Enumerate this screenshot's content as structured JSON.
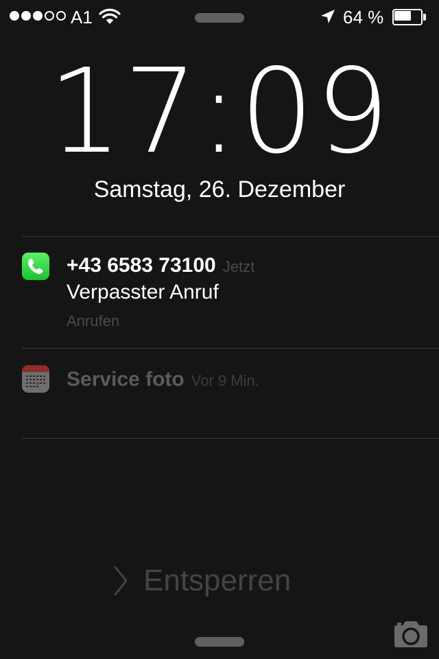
{
  "status_bar": {
    "signal_bars_filled": 3,
    "signal_bars_total": 5,
    "carrier": "A1",
    "wifi_icon": "wifi-icon",
    "location_icon": "location-arrow-icon",
    "battery_text": "64 %",
    "battery_level": 0.64
  },
  "lock_screen": {
    "time": "17:09",
    "date": "Samstag, 26. Dezember"
  },
  "notifications": [
    {
      "app_icon": "phone-app-icon",
      "title": "+43 6583 73100",
      "time": "Jetzt",
      "body": "Verpasster Anruf",
      "action": "Anrufen"
    },
    {
      "app_icon": "calendar-app-icon",
      "title": "Service foto",
      "time": "Vor 9 Min."
    }
  ],
  "unlock": {
    "label": "Entsperren",
    "camera_icon": "camera-icon"
  },
  "colors": {
    "background": "#151515",
    "text": "#ffffff",
    "muted_text": "#4a4a4a",
    "phone_green": "#2ed13f",
    "divider": "#3a3a3a"
  }
}
